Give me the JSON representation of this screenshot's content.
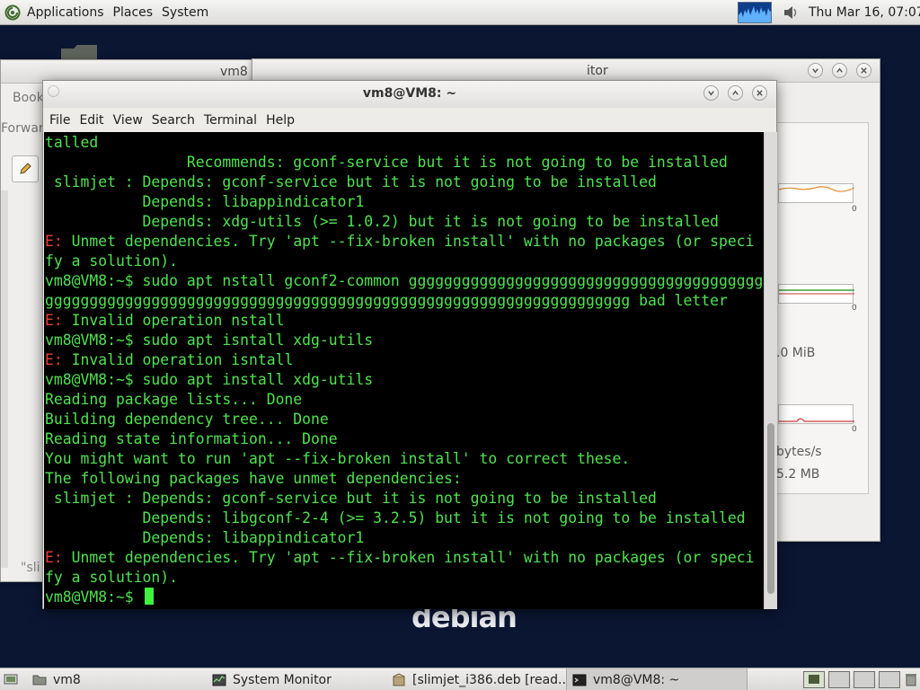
{
  "top_panel": {
    "menus": [
      "Applications",
      "Places",
      "System"
    ],
    "clock": "Thu Mar 16, 07:07",
    "icons": [
      "debian-swirl-icon",
      "cpu-monitor-graph",
      "volume-icon"
    ]
  },
  "desktop": {
    "logo_text": "debian"
  },
  "windows": {
    "files": {
      "title": "vm8",
      "sidebar_label_book": "Book",
      "sidebar_label_forward": "Forwar",
      "status_text": "\"sli"
    },
    "system_monitor": {
      "title_fragment": "itor",
      "memory_value": ".0 MiB",
      "network_rate": "bytes/s",
      "network_total": "5.2 MB",
      "axis_zero": "0"
    },
    "terminal": {
      "title": "vm8@VM8: ~",
      "menus": [
        "File",
        "Edit",
        "View",
        "Search",
        "Terminal",
        "Help"
      ],
      "lines": [
        {
          "text": "talled"
        },
        {
          "text": "                Recommends: gconf-service but it is not going to be installed"
        },
        {
          "text": " slimjet : Depends: gconf-service but it is not going to be installed"
        },
        {
          "text": "           Depends: libappindicator1"
        },
        {
          "text": "           Depends: xdg-utils (>= 1.0.2) but it is not going to be installed"
        },
        {
          "prefix": "E:",
          "text": " Unmet dependencies. Try 'apt --fix-broken install' with no packages (or speci"
        },
        {
          "text": "fy a solution)."
        },
        {
          "text": "vm8@VM8:~$ sudo apt nstall gconf2-common gggggggggggggggggggggggggggggggggggggggg"
        },
        {
          "text": "gggggggggggggggggggggggggggggggggggggggggggggggggggggggggggggggggg bad letter"
        },
        {
          "prefix": "E:",
          "text": " Invalid operation nstall"
        },
        {
          "text": "vm8@VM8:~$ sudo apt isntall xdg-utils"
        },
        {
          "prefix": "E:",
          "text": " Invalid operation isntall"
        },
        {
          "text": "vm8@VM8:~$ sudo apt install xdg-utils"
        },
        {
          "text": "Reading package lists... Done"
        },
        {
          "text": "Building dependency tree... Done"
        },
        {
          "text": "Reading state information... Done"
        },
        {
          "text": "You might want to run 'apt --fix-broken install' to correct these."
        },
        {
          "text": "The following packages have unmet dependencies:"
        },
        {
          "text": " slimjet : Depends: gconf-service but it is not going to be installed"
        },
        {
          "text": "           Depends: libgconf-2-4 (>= 3.2.5) but it is not going to be installed"
        },
        {
          "text": "           Depends: libappindicator1"
        },
        {
          "prefix": "E:",
          "text": " Unmet dependencies. Try 'apt --fix-broken install' with no packages (or speci"
        },
        {
          "text": "fy a solution)."
        }
      ],
      "prompt": "vm8@VM8:~$ ",
      "colors": {
        "text": "#4fe34f",
        "error": "#ef3a3a",
        "background": "#000000"
      }
    }
  },
  "taskbar": {
    "items": [
      {
        "label": "vm8",
        "icon": "folder-icon"
      },
      {
        "label": "System Monitor",
        "icon": "system-monitor-icon"
      },
      {
        "label": "[slimjet_i386.deb [read...",
        "icon": "package-icon"
      },
      {
        "label": "vm8@VM8: ~",
        "icon": "terminal-icon",
        "active": true
      }
    ]
  }
}
